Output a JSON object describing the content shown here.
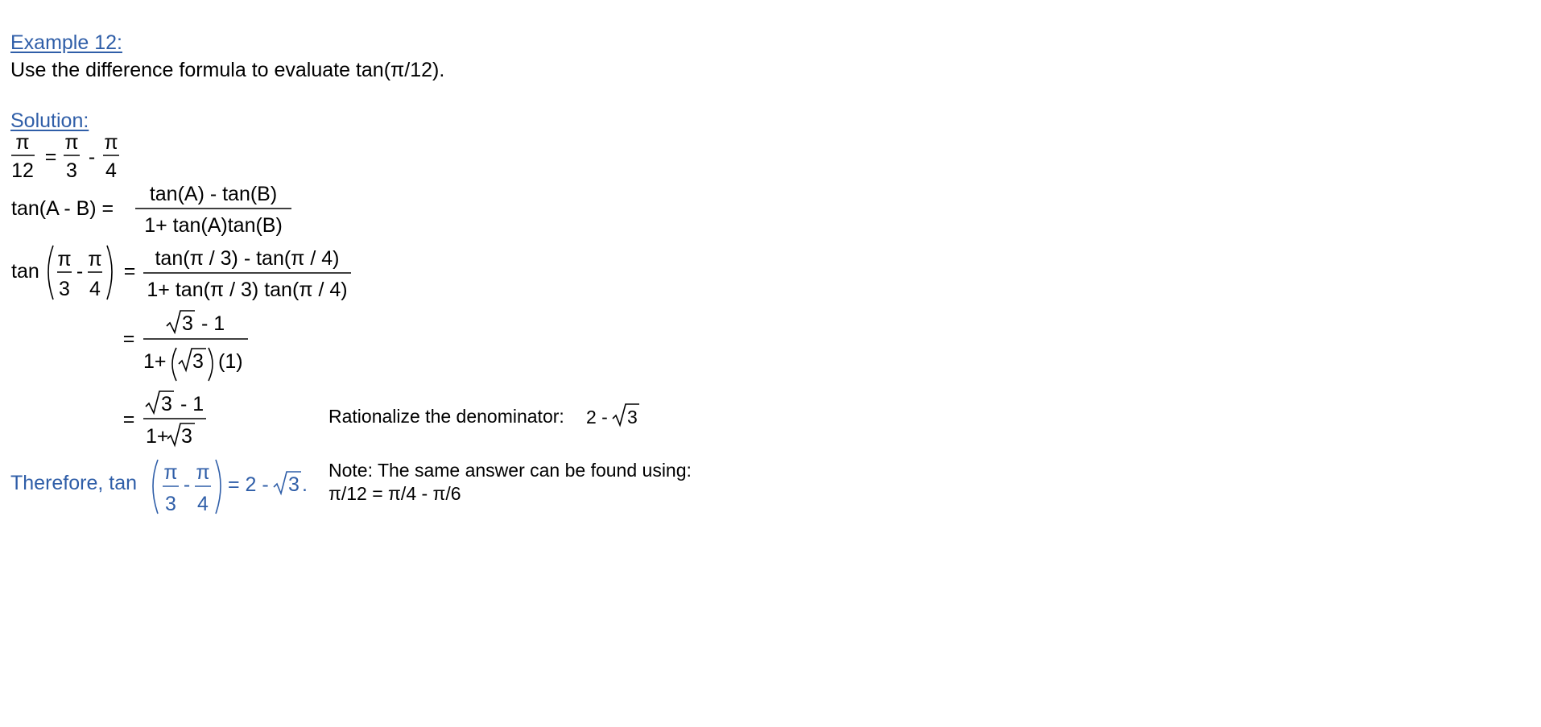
{
  "example": {
    "heading": "Example 12:",
    "prompt": "Use the difference formula to evaluate tan(π/12)."
  },
  "solution": {
    "heading": "Solution:",
    "line1": {
      "lhs_num": "π",
      "lhs_den": "12",
      "eq": "=",
      "a_num": "π",
      "a_den": "3",
      "minus": "-",
      "b_num": "π",
      "b_den": "4"
    },
    "line2": {
      "lhs": "tan(A - B) =",
      "num": "tan(A) - tan(B)",
      "den": "1+ tan(A)tan(B)"
    },
    "line3": {
      "fn": "tan",
      "a_num": "π",
      "a_den": "3",
      "minus": "-",
      "b_num": "π",
      "b_den": "4",
      "eq": "=",
      "num": "tan(π / 3) - tan(π / 4)",
      "den": "1+ tan(π / 3) tan(π / 4)"
    },
    "line4": {
      "eq": "=",
      "num_rad": "3",
      "num_rest": "- 1",
      "den_start": "1+",
      "den_rad": "3",
      "den_end": "(1)"
    },
    "line5": {
      "eq": "=",
      "num_rad": "3",
      "num_rest": "- 1",
      "den_start": "1+",
      "den_rad": "3"
    },
    "rationalize": {
      "text": "Rationalize the denominator:",
      "expr_start": "2 -",
      "expr_rad": "3"
    },
    "therefore": {
      "label": "Therefore, tan",
      "a_num": "π",
      "a_den": "3",
      "minus": "-",
      "b_num": "π",
      "b_den": "4",
      "result_start": "= 2 -",
      "result_rad": "3",
      "result_end": "."
    },
    "note": {
      "line1": "Note:  The same answer can be found using:",
      "line2": "π/12 = π/4 - π/6"
    }
  },
  "colors": {
    "heading": "#2f5ea8",
    "text": "#000000",
    "background": "#ffffff"
  }
}
